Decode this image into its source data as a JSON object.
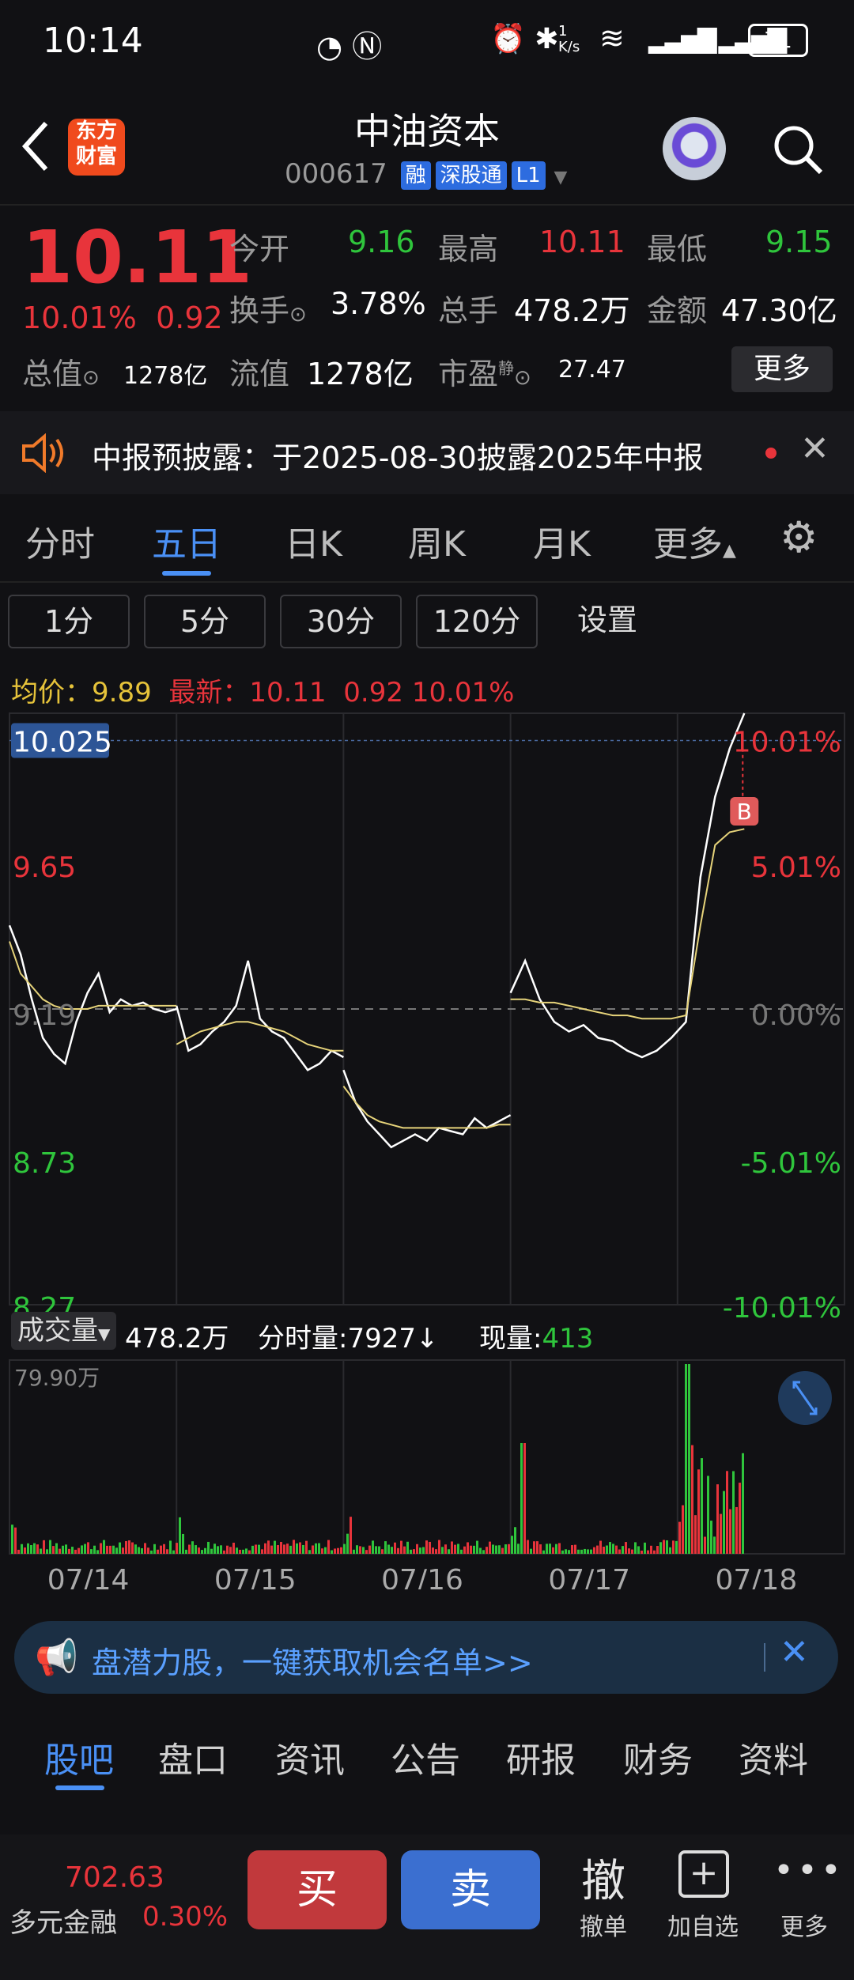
{
  "status_bar": {
    "time": "10:14",
    "net_speed": "1 K/s",
    "battery": "71"
  },
  "header": {
    "title": "中油资本",
    "code": "000617",
    "tags": [
      "融",
      "深股通",
      "L1"
    ]
  },
  "quote": {
    "price": "10.11",
    "change_pct": "10.01%",
    "change": "0.92",
    "open_label": "今开",
    "open": "9.16",
    "high_label": "最高",
    "high": "10.11",
    "low_label": "最低",
    "low": "9.15",
    "turnover_label": "换手",
    "turnover": "3.78%",
    "volume_label": "总手",
    "volume": "478.2万",
    "amount_label": "金额",
    "amount": "47.30亿",
    "mcap_label": "总值",
    "mcap": "1278亿",
    "float_label": "流值",
    "float": "1278亿",
    "pe_label": "市盈",
    "pe_sup": "静",
    "pe": "27.47",
    "more_label": "更多"
  },
  "notice": {
    "text": "中报预披露：于2025-08-30披露2025年中报"
  },
  "tabs": [
    "分时",
    "五日",
    "日K",
    "周K",
    "月K",
    "更多"
  ],
  "subtabs": [
    "1分",
    "5分",
    "30分",
    "120分",
    "设置"
  ],
  "info_line": {
    "avg_label": "均价：",
    "avg": "9.89",
    "latest_label": "最新：",
    "latest": "10.11",
    "chg": "0.92",
    "pct": "10.01%"
  },
  "chart_data": {
    "type": "line",
    "title": "",
    "price_axis": [
      "10.025",
      "9.65",
      "9.19",
      "8.73",
      "8.27"
    ],
    "pct_axis": [
      "10.01%",
      "5.01%",
      "0.00%",
      "-5.01%",
      "-10.01%"
    ],
    "dates": [
      "07/14",
      "07/15",
      "07/16",
      "07/17",
      "07/18"
    ],
    "ylim": [
      8.27,
      10.11
    ],
    "prev_close": 9.19,
    "marker": "B",
    "series": [
      {
        "name": "",
        "color": "#ffffff",
        "values": [
          9.45,
          9.36,
          9.22,
          9.1,
          9.05,
          9.02,
          9.15,
          9.24,
          9.3,
          9.18,
          9.22,
          9.2,
          9.21,
          9.19,
          9.18,
          9.19,
          9.2,
          9.06,
          9.08,
          9.12,
          9.15,
          9.2,
          9.34,
          9.16,
          9.12,
          9.1,
          9.05,
          9.0,
          9.02,
          9.06,
          9.04,
          9.0,
          8.9,
          8.84,
          8.8,
          8.76,
          8.78,
          8.8,
          8.78,
          8.82,
          8.81,
          8.8,
          8.85,
          8.82,
          8.84,
          8.86,
          9.24,
          9.34,
          9.22,
          9.15,
          9.12,
          9.14,
          9.1,
          9.09,
          9.06,
          9.04,
          9.06,
          9.1,
          9.15,
          9.6,
          9.85,
          10.0,
          10.11
        ]
      },
      {
        "name": "",
        "color": "#e6d37a",
        "values": [
          9.4,
          9.3,
          9.26,
          9.22,
          9.2,
          9.19,
          9.19,
          9.19,
          9.2,
          9.2,
          9.2,
          9.2,
          9.2,
          9.2,
          9.2,
          9.2,
          9.08,
          9.1,
          9.12,
          9.13,
          9.14,
          9.15,
          9.15,
          9.14,
          9.13,
          9.12,
          9.1,
          9.08,
          9.07,
          9.06,
          9.06,
          8.95,
          8.9,
          8.86,
          8.84,
          8.83,
          8.82,
          8.82,
          8.82,
          8.82,
          8.82,
          8.82,
          8.82,
          8.82,
          8.83,
          8.83,
          9.22,
          9.22,
          9.21,
          9.21,
          9.2,
          9.19,
          9.18,
          9.17,
          9.17,
          9.16,
          9.16,
          9.16,
          9.17,
          9.45,
          9.7,
          9.74,
          9.75
        ]
      }
    ],
    "volume_max_label": "79.90万"
  },
  "volume_header": {
    "label": "成交量",
    "total": "478.2万",
    "min_label": "分时量:",
    "min_val": "7927",
    "now_label": "现量:",
    "now_val": "413"
  },
  "ad": {
    "text": "盘潜力股，一键获取机会名单>>"
  },
  "bottom_tabs": [
    "股吧",
    "盘口",
    "资讯",
    "公告",
    "研报",
    "财务",
    "资料"
  ],
  "bottom_bar": {
    "index_value": "702.63",
    "index_name": "多元金融",
    "index_pct": "0.30%",
    "buy": "买",
    "sell": "卖",
    "cancel": "撤单",
    "cancel_icon": "撤",
    "add": "加自选",
    "more": "更多"
  },
  "colors": {
    "up": "#e8343b",
    "down": "#2fc53c",
    "accent": "#4a90f5"
  }
}
